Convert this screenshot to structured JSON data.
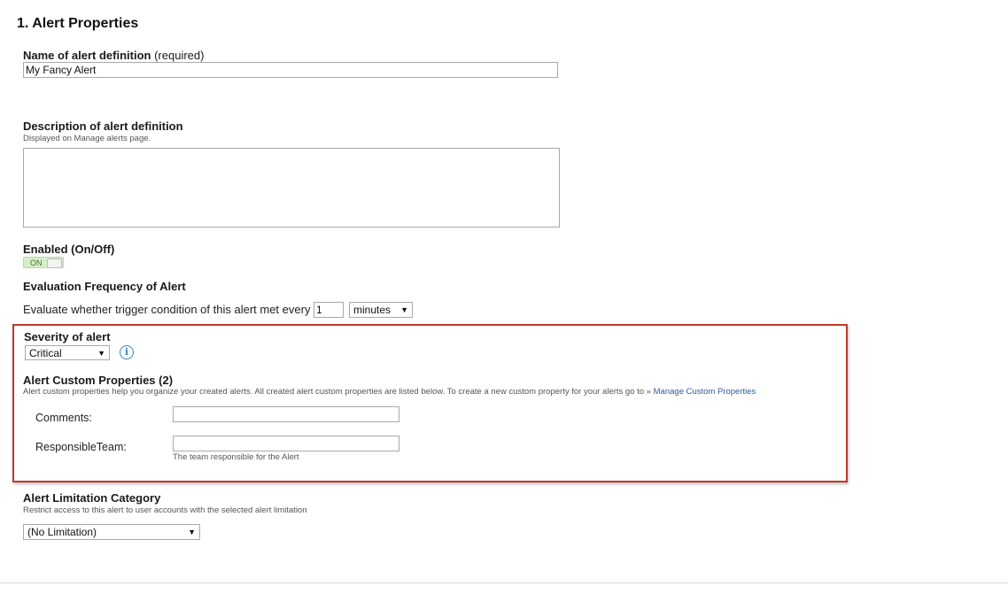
{
  "page": {
    "title": "1. Alert Properties"
  },
  "name_field": {
    "label": "Name of alert definition",
    "label_suffix": "(required)",
    "value": "My Fancy Alert"
  },
  "description_field": {
    "label": "Description of alert definition",
    "hint": "Displayed on Manage alerts page.",
    "value": ""
  },
  "enabled": {
    "label": "Enabled (On/Off)",
    "state_text": "ON",
    "is_on": true
  },
  "frequency": {
    "label": "Evaluation Frequency of Alert",
    "sentence": "Evaluate whether trigger condition of this alert met every",
    "value": "1",
    "unit": "minutes"
  },
  "severity": {
    "label": "Severity of alert",
    "selected": "Critical",
    "info_icon_glyph": "i"
  },
  "custom_properties": {
    "label": "Alert Custom Properties (2)",
    "hint_text": "Alert custom properties help you organize your created alerts. All created alert custom properties are listed below. To create a new custom property for your alerts go to",
    "link_prefix": "»",
    "link_text": "Manage Custom Properties",
    "items": [
      {
        "label": "Comments:",
        "value": "",
        "hint": ""
      },
      {
        "label": "ResponsibleTeam:",
        "value": "",
        "hint": "The team responsible for the Alert"
      }
    ]
  },
  "limitation": {
    "label": "Alert Limitation Category",
    "hint": "Restrict access to this alert to user accounts with the selected alert limitation",
    "selected": "(No Limitation)"
  },
  "colors": {
    "highlight_border": "#c0392b",
    "toggle_on_bg": "#d8efcc",
    "link": "#2a5d9f",
    "info_icon": "#3a86c8"
  },
  "icons": {
    "info": "info-icon",
    "dropdown": "chevron-down-icon"
  }
}
